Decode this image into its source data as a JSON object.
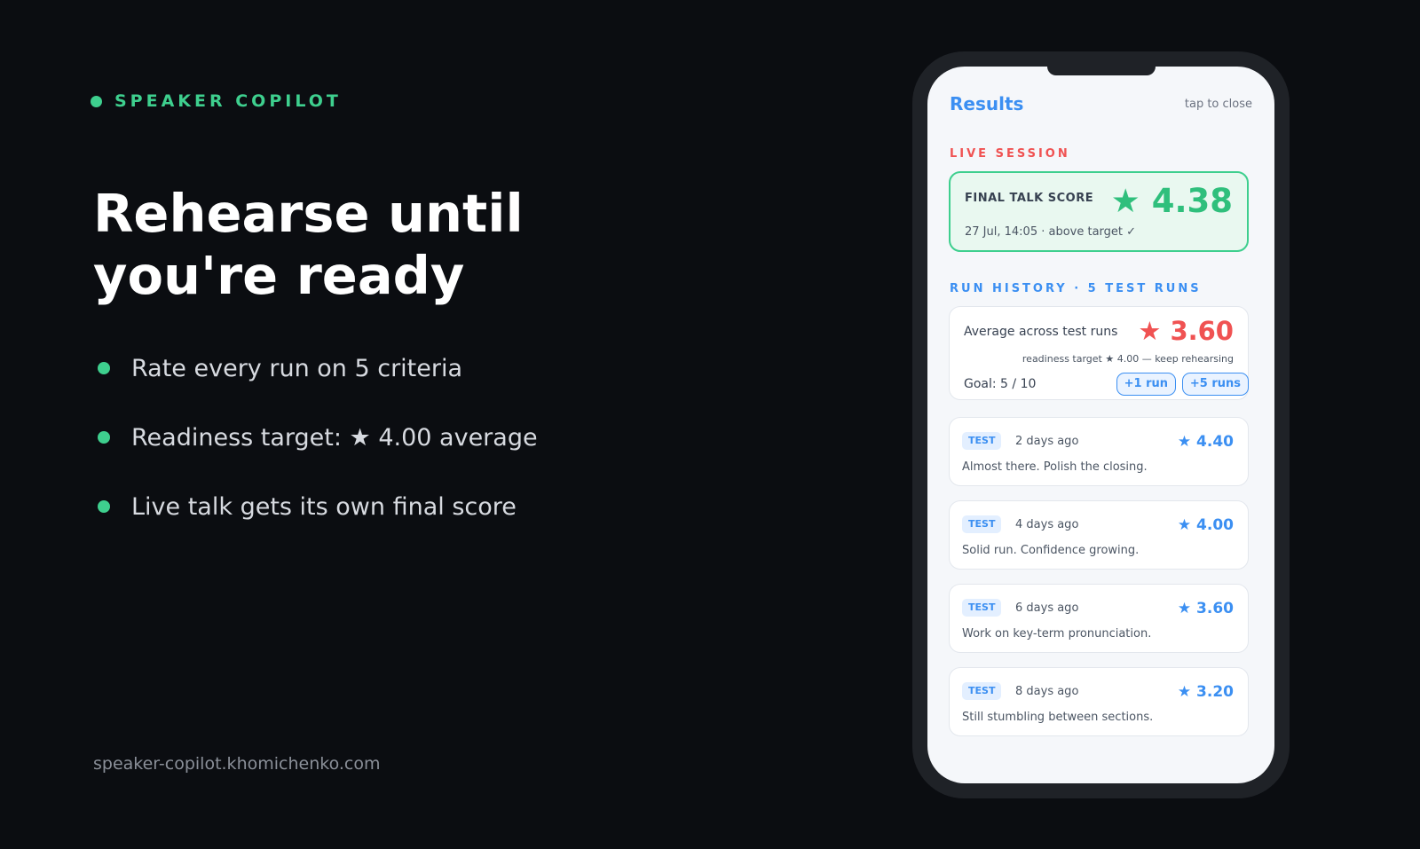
{
  "brand": {
    "name": "SPEAKER COPILOT"
  },
  "hero": {
    "headline_line1": "Rehearse until",
    "headline_line2": "you're ready",
    "bullets": [
      "Rate every run on 5 criteria",
      "Readiness target: ★ 4.00 average",
      "Live talk gets its own final score"
    ]
  },
  "footer": {
    "url": "speaker-copilot.khomichenko.com"
  },
  "phone": {
    "header": {
      "title": "Results",
      "close_label": "tap to close"
    },
    "live_session": {
      "section_label": "LIVE SESSION",
      "final_label": "FINAL TALK SCORE",
      "score": "★ 4.38",
      "meta": "27 Jul, 14:05 · above target ✓"
    },
    "run_history": {
      "section_label": "RUN HISTORY · 5 TEST RUNS",
      "average_label": "Average across test runs",
      "average_score": "★ 3.60",
      "target_note": "readiness target ★ 4.00 — keep rehearsing",
      "goal": "Goal: 5 / 10",
      "add_one_label": "+1 run",
      "add_five_label": "+5 runs",
      "runs": [
        {
          "badge": "TEST",
          "when": "2 days ago",
          "score": "★ 4.40",
          "note": "Almost there. Polish the closing."
        },
        {
          "badge": "TEST",
          "when": "4 days ago",
          "score": "★ 4.00",
          "note": "Solid run. Confidence growing."
        },
        {
          "badge": "TEST",
          "when": "6 days ago",
          "score": "★ 3.60",
          "note": "Work on key-term pronunciation."
        },
        {
          "badge": "TEST",
          "when": "8 days ago",
          "score": "★ 3.20",
          "note": "Still stumbling between sections."
        }
      ]
    }
  },
  "colors": {
    "background": "#0b0d11",
    "accent_green": "#3ecf8e",
    "accent_blue": "#3b8ff2",
    "accent_red": "#f05252"
  }
}
